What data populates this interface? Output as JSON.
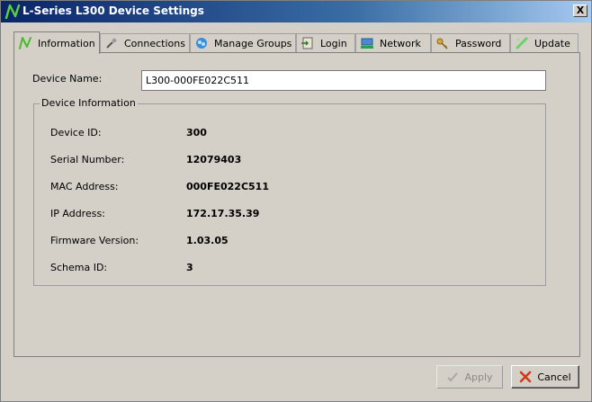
{
  "window": {
    "title": "L-Series L300 Device Settings",
    "close_label": "X"
  },
  "tabs": [
    {
      "label": "Information",
      "icon": "logo-n-icon",
      "active": true
    },
    {
      "label": "Connections",
      "icon": "plug-icon",
      "active": false
    },
    {
      "label": "Manage Groups",
      "icon": "groups-icon",
      "active": false
    },
    {
      "label": "Login",
      "icon": "login-icon",
      "active": false
    },
    {
      "label": "Network",
      "icon": "network-icon",
      "active": false
    },
    {
      "label": "Password",
      "icon": "key-icon",
      "active": false
    },
    {
      "label": "Update",
      "icon": "update-icon",
      "active": false
    }
  ],
  "device_name": {
    "label": "Device Name:",
    "value": "L300-000FE022C511"
  },
  "device_info": {
    "legend": "Device Information",
    "rows": [
      {
        "label": "Device ID:",
        "value": "300"
      },
      {
        "label": "Serial Number:",
        "value": "12079403"
      },
      {
        "label": "MAC Address:",
        "value": "000FE022C511"
      },
      {
        "label": "IP Address:",
        "value": "172.17.35.39"
      },
      {
        "label": "Firmware Version:",
        "value": "1.03.05"
      },
      {
        "label": "Schema ID:",
        "value": "3"
      }
    ]
  },
  "buttons": {
    "apply": "Apply",
    "cancel": "Cancel"
  },
  "colors": {
    "accent_green": "#3a9a2a",
    "titlebar": "#0a246a",
    "cancel_red": "#d23a1a"
  }
}
